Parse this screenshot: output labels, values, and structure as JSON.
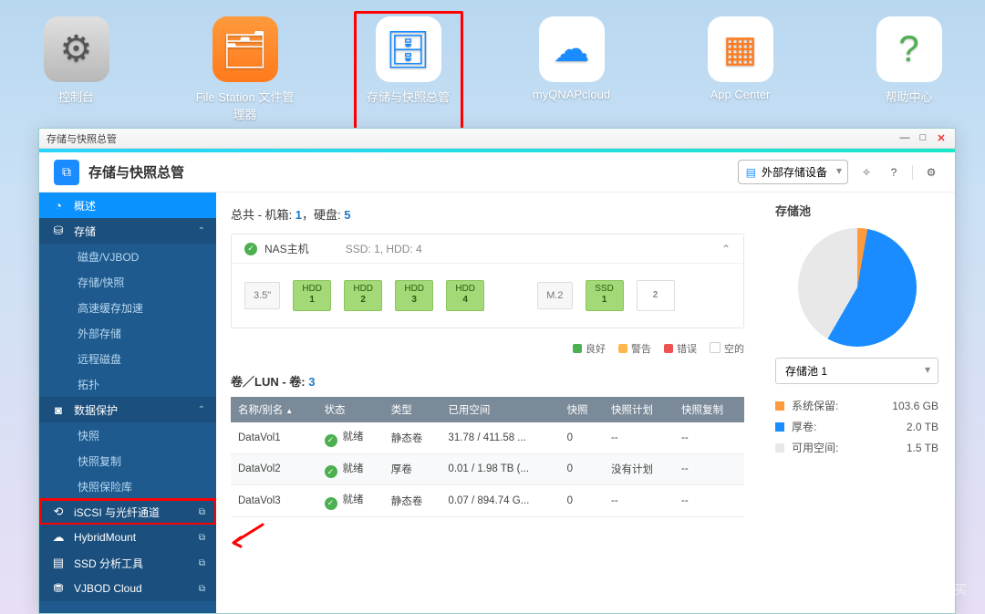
{
  "desktop": {
    "icons": [
      {
        "label": "控制台"
      },
      {
        "label": "File Station 文件管理器"
      },
      {
        "label": "存储与快照总管"
      },
      {
        "label": "myQNAPcloud"
      },
      {
        "label": "App Center"
      },
      {
        "label": "帮助中心"
      }
    ]
  },
  "window": {
    "title": "存储与快照总管"
  },
  "header": {
    "title": "存储与快照总管",
    "ext_device": "外部存储设备"
  },
  "sidebar": {
    "overview": "概述",
    "storage": "存储",
    "storage_items": [
      "磁盘/VJBOD",
      "存储/快照",
      "高速缓存加速",
      "外部存储",
      "远程磁盘",
      "拓扑"
    ],
    "data_protect": "数据保护",
    "protect_items": [
      "快照",
      "快照复制",
      "快照保险库"
    ],
    "iscsi": "iSCSI 与光纤通道",
    "hybrid": "HybridMount",
    "ssd": "SSD 分析工具",
    "vjbod": "VJBOD Cloud"
  },
  "summary": {
    "label": "总共 - 机箱:",
    "chassis": "1",
    "sep": "，硬盘:",
    "disks": "5"
  },
  "hostpanel": {
    "name": "NAS主机",
    "spec": "SSD: 1, HDD: 4",
    "bay35": "3.5\"",
    "bayM2": "M.2",
    "hdds": [
      {
        "t": "HDD",
        "n": "1"
      },
      {
        "t": "HDD",
        "n": "2"
      },
      {
        "t": "HDD",
        "n": "3"
      },
      {
        "t": "HDD",
        "n": "4"
      }
    ],
    "ssds": [
      {
        "t": "SSD",
        "n": "1"
      },
      {
        "t": "",
        "n": "2"
      }
    ]
  },
  "legend": {
    "good": "良好",
    "warn": "警告",
    "err": "错误",
    "free": "空的"
  },
  "volsec": {
    "label": "卷／LUN - 卷:",
    "count": "3"
  },
  "cols": [
    "名称/别名",
    "状态",
    "类型",
    "已用空间",
    "快照",
    "快照计划",
    "快照复制"
  ],
  "rows": [
    {
      "name": "DataVol1",
      "status": "就绪",
      "type": "静态卷",
      "used": "31.78 / 411.58 ...",
      "snap": "0",
      "plan": "--",
      "rep": "--"
    },
    {
      "name": "DataVol2",
      "status": "就绪",
      "type": "厚卷",
      "used": "0.01 / 1.98 TB (...",
      "snap": "0",
      "plan": "没有计划",
      "rep": "--"
    },
    {
      "name": "DataVol3",
      "status": "就绪",
      "type": "静态卷",
      "used": "0.07 / 894.74 G...",
      "snap": "0",
      "plan": "--",
      "rep": "--"
    }
  ],
  "aside": {
    "title": "存储池",
    "pool": "存储池 1",
    "rows": [
      {
        "label": "系统保留:",
        "val": "103.6 GB",
        "color": "#ff9a3c"
      },
      {
        "label": "厚卷:",
        "val": "2.0 TB",
        "color": "#1a8cff"
      },
      {
        "label": "可用空间:",
        "val": "1.5 TB",
        "color": "#e8e8e8"
      }
    ]
  },
  "watermark": "什么值得买",
  "chart_data": {
    "type": "pie",
    "title": "存储池 1",
    "series": [
      {
        "name": "系统保留",
        "value": 103.6,
        "unit": "GB",
        "color": "#ff9a3c"
      },
      {
        "name": "厚卷",
        "value": 2.0,
        "unit": "TB",
        "color": "#1a8cff"
      },
      {
        "name": "可用空间",
        "value": 1.5,
        "unit": "TB",
        "color": "#e8e8e8"
      }
    ]
  }
}
